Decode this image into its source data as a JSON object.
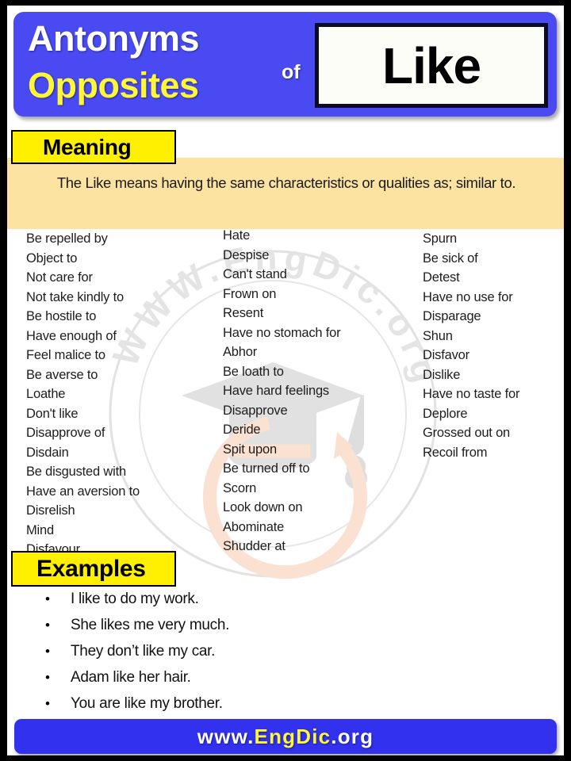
{
  "header": {
    "line1": "Antonyms",
    "line2": "Opposites",
    "connector": "of",
    "word": "Like"
  },
  "meaning": {
    "tag_label": "Meaning",
    "text": "The Like means having the same characteristics or qualities as; similar to."
  },
  "antonyms": {
    "column1": [
      "Be repelled by",
      "Object to",
      "Not care for",
      "Not take kindly to",
      "Be hostile to",
      "Have enough of",
      "Feel malice to",
      "Be averse to",
      "Loathe",
      "Don't like",
      "Disapprove of",
      "Disdain",
      "Be disgusted with",
      "Have an aversion to",
      "Disrelish",
      "Mind",
      "Disfavour"
    ],
    "column2": [
      "Hate",
      "Despise",
      "Can't stand",
      "Frown on",
      "Resent",
      "Have no stomach for",
      "Abhor",
      "Be loath to",
      "Have hard feelings",
      "Disapprove",
      "Deride",
      "Spit upon",
      "Be turned off to",
      "Scorn",
      "Look down on",
      "Abominate",
      "Shudder at"
    ],
    "column3": [
      "Spurn",
      "Be sick of",
      "Detest",
      "Have no use for",
      "Disparage",
      "Shun",
      "Disfavor",
      "Dislike",
      "Have no taste for",
      "Deplore",
      "Grossed out on",
      "Recoil from"
    ]
  },
  "examples": {
    "tag_label": "Examples",
    "bullet": "•",
    "items": [
      "I like to do my work.",
      "She likes me very much.",
      "They don’t like my car.",
      "Adam like her hair.",
      "You are like my brother."
    ]
  },
  "footer": {
    "prefix": "www.",
    "brand": "EngDic",
    "suffix": ".org"
  },
  "watermark": {
    "text": "WWW.EngDic.org"
  },
  "colors": {
    "header_blue": "#4a4af2",
    "footer_blue": "#3232ee",
    "tag_yellow": "#fff000",
    "title_yellow": "#fdf738",
    "meaning_bg": "#fce3a1",
    "frame_black": "#000000"
  }
}
